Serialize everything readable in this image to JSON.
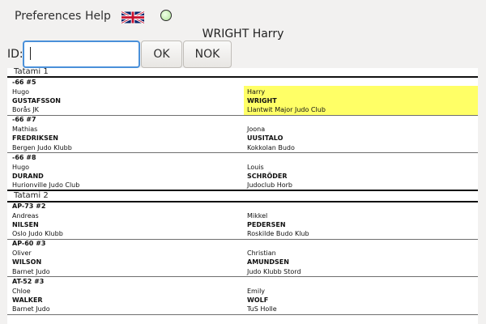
{
  "menu": {
    "preferences": "Preferences",
    "help": "Help",
    "language_icon": "uk-flag-icon",
    "status_icon": "status-indicator-icon"
  },
  "player_name": "WRIGHT Harry",
  "id_field": {
    "label": "ID:",
    "value": ""
  },
  "buttons": {
    "ok": "OK",
    "nok": "NOK"
  },
  "colors": {
    "highlight": "#ffff66",
    "input_border": "#4a90d9"
  },
  "tatamis": [
    {
      "name": "Tatami 1",
      "fights": [
        {
          "category": "-66 #5",
          "left": {
            "first": "Hugo",
            "last": "GUSTAFSSON",
            "club": "Borås JK"
          },
          "right": {
            "first": "Harry",
            "last": "WRIGHT",
            "club": "Llantwit Major Judo Club"
          },
          "highlight": "right"
        },
        {
          "category": "-66 #7",
          "left": {
            "first": "Mathias",
            "last": "FREDRIKSEN",
            "club": "Bergen Judo Klubb"
          },
          "right": {
            "first": "Joona",
            "last": "UUSITALO",
            "club": "Kokkolan Budo"
          }
        },
        {
          "category": "-66 #8",
          "left": {
            "first": "Hugo",
            "last": "DURAND",
            "club": "Hurionville Judo Club"
          },
          "right": {
            "first": "Louis",
            "last": "SCHRÖDER",
            "club": "Judoclub Horb"
          }
        }
      ]
    },
    {
      "name": "Tatami 2",
      "fights": [
        {
          "category": "AP-73 #2",
          "left": {
            "first": "Andreas",
            "last": "NILSEN",
            "club": "Oslo Judo Klubb"
          },
          "right": {
            "first": "Mikkel",
            "last": "PEDERSEN",
            "club": "Roskilde Budo Klub"
          }
        },
        {
          "category": "AP-60 #3",
          "left": {
            "first": "Oliver",
            "last": "WILSON",
            "club": "Barnet Judo"
          },
          "right": {
            "first": "Christian",
            "last": "AMUNDSEN",
            "club": "Judo Klubb Stord"
          }
        },
        {
          "category": "AT-52 #3",
          "left": {
            "first": "Chloe",
            "last": "WALKER",
            "club": "Barnet Judo"
          },
          "right": {
            "first": "Emily",
            "last": "WOLF",
            "club": "TuS Holle"
          }
        }
      ]
    }
  ]
}
